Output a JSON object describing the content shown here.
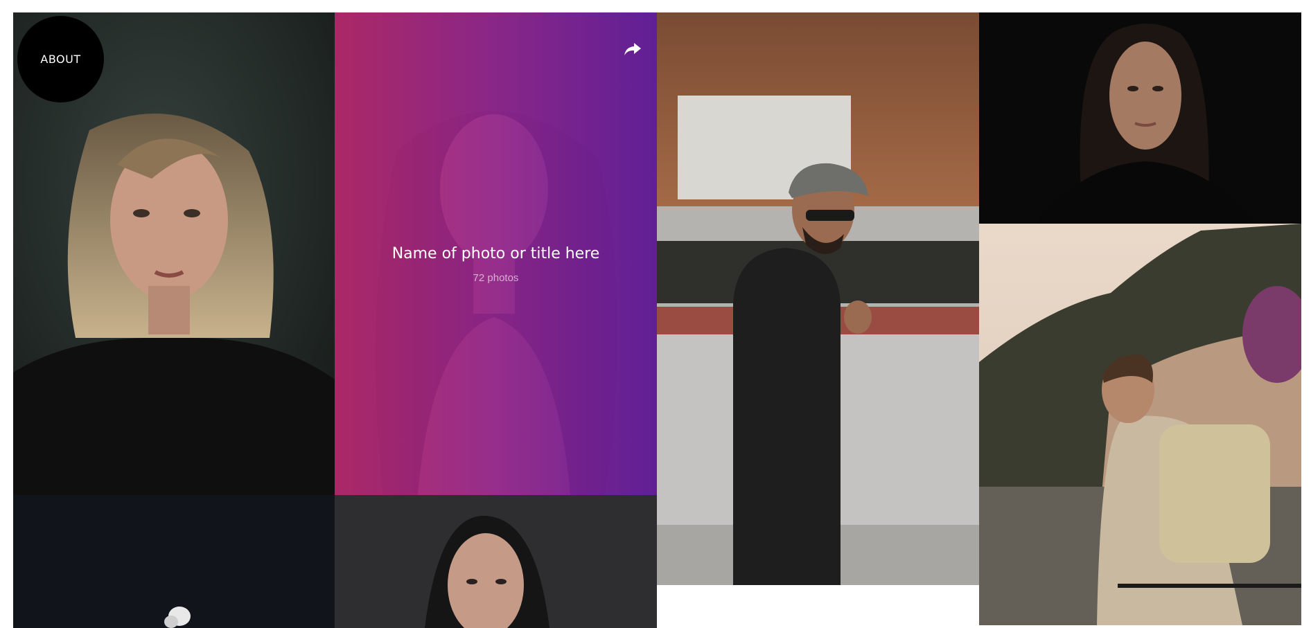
{
  "about_button": {
    "label": "ABOUT"
  },
  "featured": {
    "title": "Name of photo or title here",
    "count": "72 photos"
  },
  "icons": {
    "share": "share-arrow-icon"
  },
  "colors": {
    "overlay_start": "#be286e",
    "overlay_end": "#641ea0",
    "about_bg": "#000000",
    "page_bg": "#ffffff"
  }
}
